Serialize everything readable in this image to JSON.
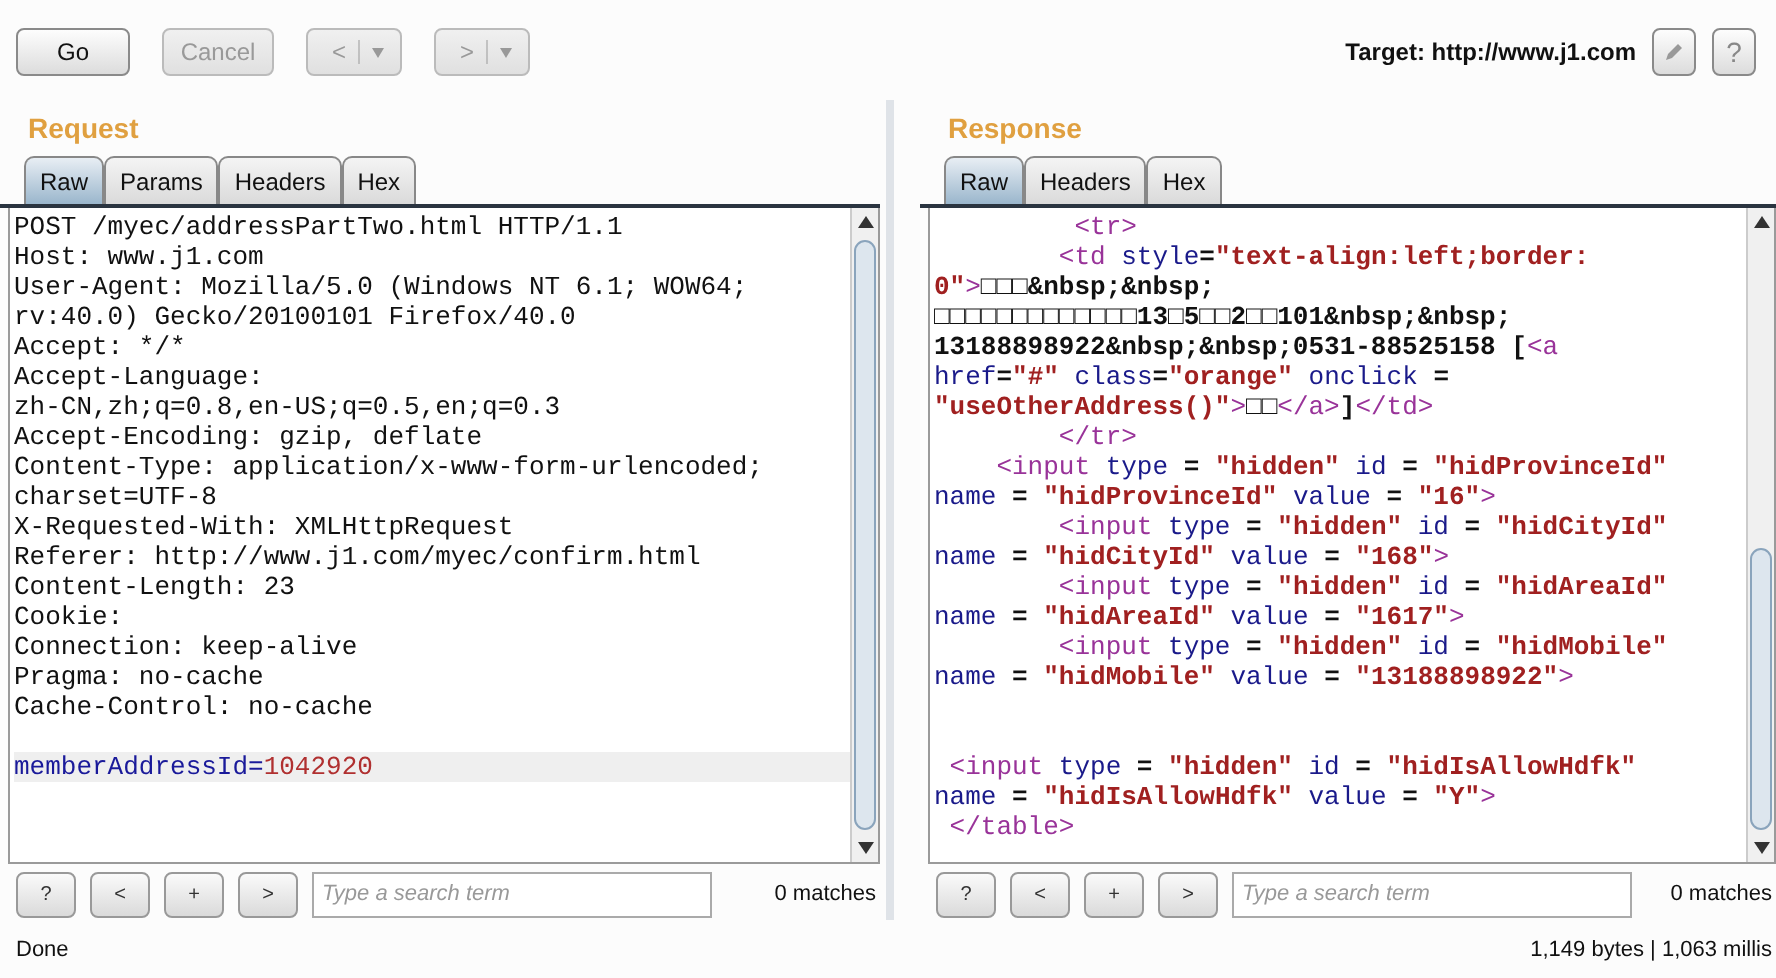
{
  "toolbar": {
    "buttons": [
      {
        "kind": "plain",
        "label": "Go",
        "disabled": false
      },
      {
        "kind": "plain",
        "label": "Cancel",
        "disabled": true
      },
      {
        "kind": "dropdown",
        "label": "<",
        "disabled": true
      },
      {
        "kind": "dropdown",
        "label": ">",
        "disabled": true
      }
    ],
    "target": "Target: http://www.j1.com",
    "help_button": "?"
  },
  "request": {
    "title": "Request",
    "tabs": [
      {
        "label": "Raw",
        "selected": true
      },
      {
        "label": "Params",
        "selected": false
      },
      {
        "label": "Headers",
        "selected": false
      },
      {
        "label": "Hex",
        "selected": false
      }
    ],
    "lines": [
      {
        "kind": "text",
        "text": "POST /myec/addressPartTwo.html HTTP/1.1"
      },
      {
        "kind": "text",
        "text": "Host: www.j1.com"
      },
      {
        "kind": "text",
        "text": "User-Agent: Mozilla/5.0 (Windows NT 6.1; WOW64;"
      },
      {
        "kind": "text",
        "text": "rv:40.0) Gecko/20100101 Firefox/40.0"
      },
      {
        "kind": "text",
        "text": "Accept: */*"
      },
      {
        "kind": "text",
        "text": "Accept-Language:"
      },
      {
        "kind": "text",
        "text": "zh-CN,zh;q=0.8,en-US;q=0.5,en;q=0.3"
      },
      {
        "kind": "text",
        "text": "Accept-Encoding: gzip, deflate"
      },
      {
        "kind": "text",
        "text": "Content-Type: application/x-www-form-urlencoded;"
      },
      {
        "kind": "text",
        "text": "charset=UTF-8"
      },
      {
        "kind": "text",
        "text": "X-Requested-With: XMLHttpRequest"
      },
      {
        "kind": "text",
        "text": "Referer: http://www.j1.com/myec/confirm.html"
      },
      {
        "kind": "text",
        "text": "Content-Length: 23"
      },
      {
        "kind": "text",
        "text": "Cookie:"
      },
      {
        "kind": "text",
        "text": "Connection: keep-alive"
      },
      {
        "kind": "text",
        "text": "Pragma: no-cache"
      },
      {
        "kind": "text",
        "text": "Cache-Control: no-cache"
      },
      {
        "kind": "blank"
      },
      {
        "kind": "param",
        "name": "memberAddressId=",
        "value": "1042920",
        "current": true
      }
    ],
    "search": {
      "buttons": [
        "?",
        "<",
        "+",
        ">"
      ],
      "placeholder": "Type a search term",
      "matches": "0 matches"
    }
  },
  "response": {
    "title": "Response",
    "tabs": [
      {
        "label": "Raw",
        "selected": true
      },
      {
        "label": "Headers",
        "selected": false
      },
      {
        "label": "Hex",
        "selected": false
      }
    ],
    "lines": [
      {
        "kind": "code",
        "segments": [
          {
            "kind": "tag",
            "text": "         <tr>"
          }
        ]
      },
      {
        "kind": "code",
        "segments": [
          {
            "kind": "tag",
            "text": "        <td"
          },
          {
            "kind": "attr",
            "text": " style"
          },
          {
            "kind": "plain",
            "text": "="
          },
          {
            "kind": "string",
            "text": "\"text-align:left;border:"
          }
        ]
      },
      {
        "kind": "code",
        "segments": [
          {
            "kind": "string",
            "text": "0\""
          },
          {
            "kind": "tag",
            "text": ">"
          },
          {
            "kind": "plain",
            "text": "□□□&nbsp;&nbsp;"
          }
        ]
      },
      {
        "kind": "code",
        "segments": [
          {
            "kind": "plain",
            "text": "□□□□□□□□□□□□□13□5□□2□□101&nbsp;&nbsp;"
          }
        ]
      },
      {
        "kind": "code",
        "segments": [
          {
            "kind": "plain",
            "text": "13188898922&nbsp;&nbsp;0531-88525158 ["
          },
          {
            "kind": "tag",
            "text": "<a"
          }
        ]
      },
      {
        "kind": "code",
        "segments": [
          {
            "kind": "attr",
            "text": "href"
          },
          {
            "kind": "plain",
            "text": "="
          },
          {
            "kind": "string",
            "text": "\"#\""
          },
          {
            "kind": "attr",
            "text": " class"
          },
          {
            "kind": "plain",
            "text": "="
          },
          {
            "kind": "string",
            "text": "\"orange\""
          },
          {
            "kind": "attr",
            "text": " onclick"
          },
          {
            "kind": "plain",
            "text": " ="
          }
        ]
      },
      {
        "kind": "code",
        "segments": [
          {
            "kind": "string",
            "text": "\"useOtherAddress()\""
          },
          {
            "kind": "tag",
            "text": ">"
          },
          {
            "kind": "plain",
            "text": "□□"
          },
          {
            "kind": "tag",
            "text": "</a>"
          },
          {
            "kind": "plain",
            "text": "]"
          },
          {
            "kind": "tag",
            "text": "</td>"
          }
        ]
      },
      {
        "kind": "code",
        "segments": [
          {
            "kind": "tag",
            "text": "        </tr>"
          }
        ]
      },
      {
        "kind": "code",
        "segments": [
          {
            "kind": "tag",
            "text": "    <input"
          },
          {
            "kind": "attr",
            "text": " type"
          },
          {
            "kind": "plain",
            "text": " = "
          },
          {
            "kind": "string",
            "text": "\"hidden\""
          },
          {
            "kind": "attr",
            "text": " id"
          },
          {
            "kind": "plain",
            "text": " = "
          },
          {
            "kind": "string",
            "text": "\"hidProvinceId\""
          }
        ]
      },
      {
        "kind": "code",
        "segments": [
          {
            "kind": "attr",
            "text": "name"
          },
          {
            "kind": "plain",
            "text": " = "
          },
          {
            "kind": "string",
            "text": "\"hidProvinceId\""
          },
          {
            "kind": "attr",
            "text": " value"
          },
          {
            "kind": "plain",
            "text": " = "
          },
          {
            "kind": "string",
            "text": "\"16\""
          },
          {
            "kind": "tag",
            "text": ">"
          }
        ]
      },
      {
        "kind": "code",
        "segments": [
          {
            "kind": "tag",
            "text": "        <input"
          },
          {
            "kind": "attr",
            "text": " type"
          },
          {
            "kind": "plain",
            "text": " = "
          },
          {
            "kind": "string",
            "text": "\"hidden\""
          },
          {
            "kind": "attr",
            "text": " id"
          },
          {
            "kind": "plain",
            "text": " = "
          },
          {
            "kind": "string",
            "text": "\"hidCityId\""
          }
        ]
      },
      {
        "kind": "code",
        "segments": [
          {
            "kind": "attr",
            "text": "name"
          },
          {
            "kind": "plain",
            "text": " = "
          },
          {
            "kind": "string",
            "text": "\"hidCityId\""
          },
          {
            "kind": "attr",
            "text": " value"
          },
          {
            "kind": "plain",
            "text": " = "
          },
          {
            "kind": "string",
            "text": "\"168\""
          },
          {
            "kind": "tag",
            "text": ">"
          }
        ]
      },
      {
        "kind": "code",
        "segments": [
          {
            "kind": "tag",
            "text": "        <input"
          },
          {
            "kind": "attr",
            "text": " type"
          },
          {
            "kind": "plain",
            "text": " = "
          },
          {
            "kind": "string",
            "text": "\"hidden\""
          },
          {
            "kind": "attr",
            "text": " id"
          },
          {
            "kind": "plain",
            "text": " = "
          },
          {
            "kind": "string",
            "text": "\"hidAreaId\""
          }
        ]
      },
      {
        "kind": "code",
        "segments": [
          {
            "kind": "attr",
            "text": "name"
          },
          {
            "kind": "plain",
            "text": " = "
          },
          {
            "kind": "string",
            "text": "\"hidAreaId\""
          },
          {
            "kind": "attr",
            "text": " value"
          },
          {
            "kind": "plain",
            "text": " = "
          },
          {
            "kind": "string",
            "text": "\"1617\""
          },
          {
            "kind": "tag",
            "text": ">"
          }
        ]
      },
      {
        "kind": "code",
        "segments": [
          {
            "kind": "tag",
            "text": "        <input"
          },
          {
            "kind": "attr",
            "text": " type"
          },
          {
            "kind": "plain",
            "text": " = "
          },
          {
            "kind": "string",
            "text": "\"hidden\""
          },
          {
            "kind": "attr",
            "text": " id"
          },
          {
            "kind": "plain",
            "text": " = "
          },
          {
            "kind": "string",
            "text": "\"hidMobile\""
          }
        ]
      },
      {
        "kind": "code",
        "segments": [
          {
            "kind": "attr",
            "text": "name"
          },
          {
            "kind": "plain",
            "text": " = "
          },
          {
            "kind": "string",
            "text": "\"hidMobile\""
          },
          {
            "kind": "attr",
            "text": " value"
          },
          {
            "kind": "plain",
            "text": " = "
          },
          {
            "kind": "string",
            "text": "\"13188898922\""
          },
          {
            "kind": "tag",
            "text": ">"
          }
        ]
      },
      {
        "kind": "blank"
      },
      {
        "kind": "blank"
      },
      {
        "kind": "code",
        "segments": [
          {
            "kind": "tag",
            "text": " <input"
          },
          {
            "kind": "attr",
            "text": " type"
          },
          {
            "kind": "plain",
            "text": " = "
          },
          {
            "kind": "string",
            "text": "\"hidden\""
          },
          {
            "kind": "attr",
            "text": " id"
          },
          {
            "kind": "plain",
            "text": " = "
          },
          {
            "kind": "string",
            "text": "\"hidIsAllowHdfk\""
          }
        ]
      },
      {
        "kind": "code",
        "segments": [
          {
            "kind": "attr",
            "text": "name"
          },
          {
            "kind": "plain",
            "text": " = "
          },
          {
            "kind": "string",
            "text": "\"hidIsAllowHdfk\""
          },
          {
            "kind": "attr",
            "text": " value"
          },
          {
            "kind": "plain",
            "text": " = "
          },
          {
            "kind": "string",
            "text": "\"Y\""
          },
          {
            "kind": "tag",
            "text": ">"
          }
        ]
      },
      {
        "kind": "code",
        "segments": [
          {
            "kind": "tag",
            "text": " </table>"
          }
        ]
      }
    ],
    "search": {
      "buttons": [
        "?",
        "<",
        "+",
        ">"
      ],
      "placeholder": "Type a search term",
      "matches": "0 matches"
    }
  },
  "status_bar": {
    "left": "Done",
    "right": "1,149 bytes | 1,063 millis"
  }
}
